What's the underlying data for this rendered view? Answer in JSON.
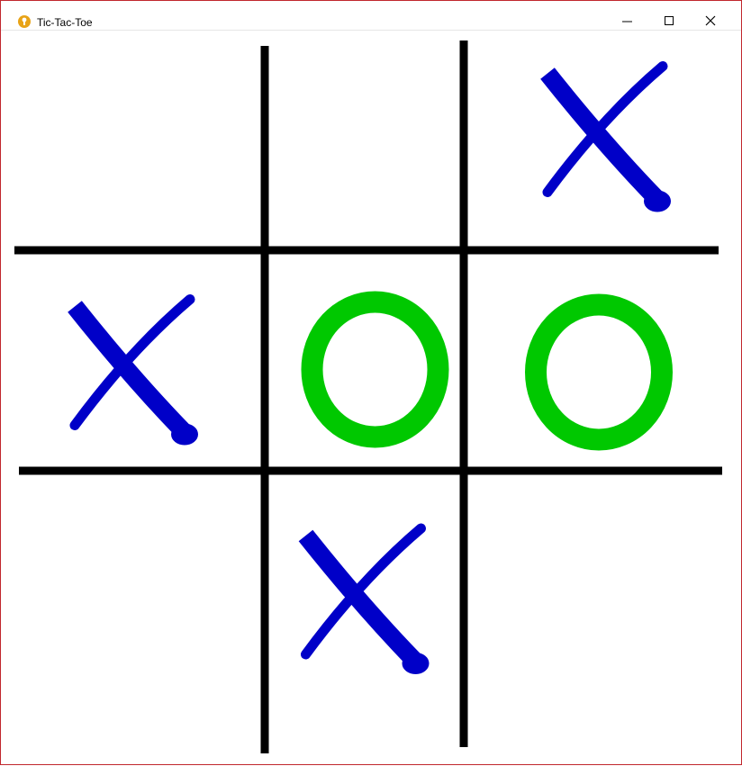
{
  "window": {
    "title": "Tic-Tac-Toe",
    "icon": "app-icon",
    "controls": [
      "minimize-icon",
      "maximize-icon",
      "close-icon"
    ]
  },
  "board": {
    "rows": 3,
    "cols": 3,
    "cells": [
      "",
      "",
      "X",
      "X",
      "O",
      "O",
      "",
      "X",
      ""
    ]
  },
  "colors": {
    "x_mark": "#0000c8",
    "o_mark": "#00c800",
    "grid": "#000000",
    "window_border": "#c1272d",
    "icon_accent": "#e8a317"
  }
}
